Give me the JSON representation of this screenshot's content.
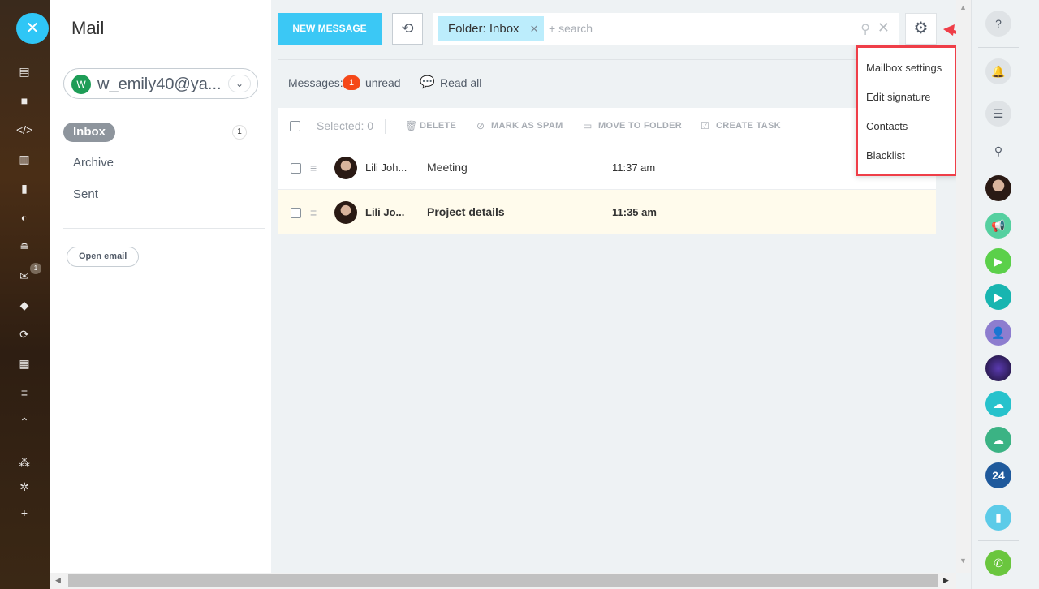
{
  "app": {
    "title": "Mail"
  },
  "account": {
    "avatar_letter": "W",
    "email": "w_emily40@ya..."
  },
  "folders": [
    {
      "label": "Inbox",
      "active": true,
      "count": "1"
    },
    {
      "label": "Archive",
      "active": false
    },
    {
      "label": "Sent",
      "active": false
    }
  ],
  "open_email_label": "Open email",
  "toolbar": {
    "new_message_label": "NEW MESSAGE",
    "filter_chip": "Folder: Inbox",
    "search_placeholder": "+ search"
  },
  "summary": {
    "messages_label": "Messages:",
    "unread_count": "1",
    "unread_label": "unread",
    "read_all_label": "Read all"
  },
  "grid": {
    "selected_label": "Selected: 0",
    "actions": {
      "delete": "DELETE",
      "spam": "MARK AS SPAM",
      "move": "MOVE TO FOLDER",
      "task": "CREATE TASK"
    },
    "rows": [
      {
        "from": "Lili Joh...",
        "subject": "Meeting",
        "time": "11:37 am",
        "unread": false
      },
      {
        "from": "Lili Jo...",
        "subject": "Project details",
        "time": "11:35 am",
        "unread": true
      }
    ]
  },
  "settings_menu": {
    "items": [
      "Mailbox settings",
      "Edit signature",
      "Contacts",
      "Blacklist"
    ]
  },
  "left_nav": {
    "mail_badge": "1"
  },
  "right_bar": {
    "calendar_label": "24"
  },
  "colors": {
    "accent": "#3bc8f5",
    "unread_badge": "#f54819",
    "highlight_border": "#ef3e48"
  }
}
